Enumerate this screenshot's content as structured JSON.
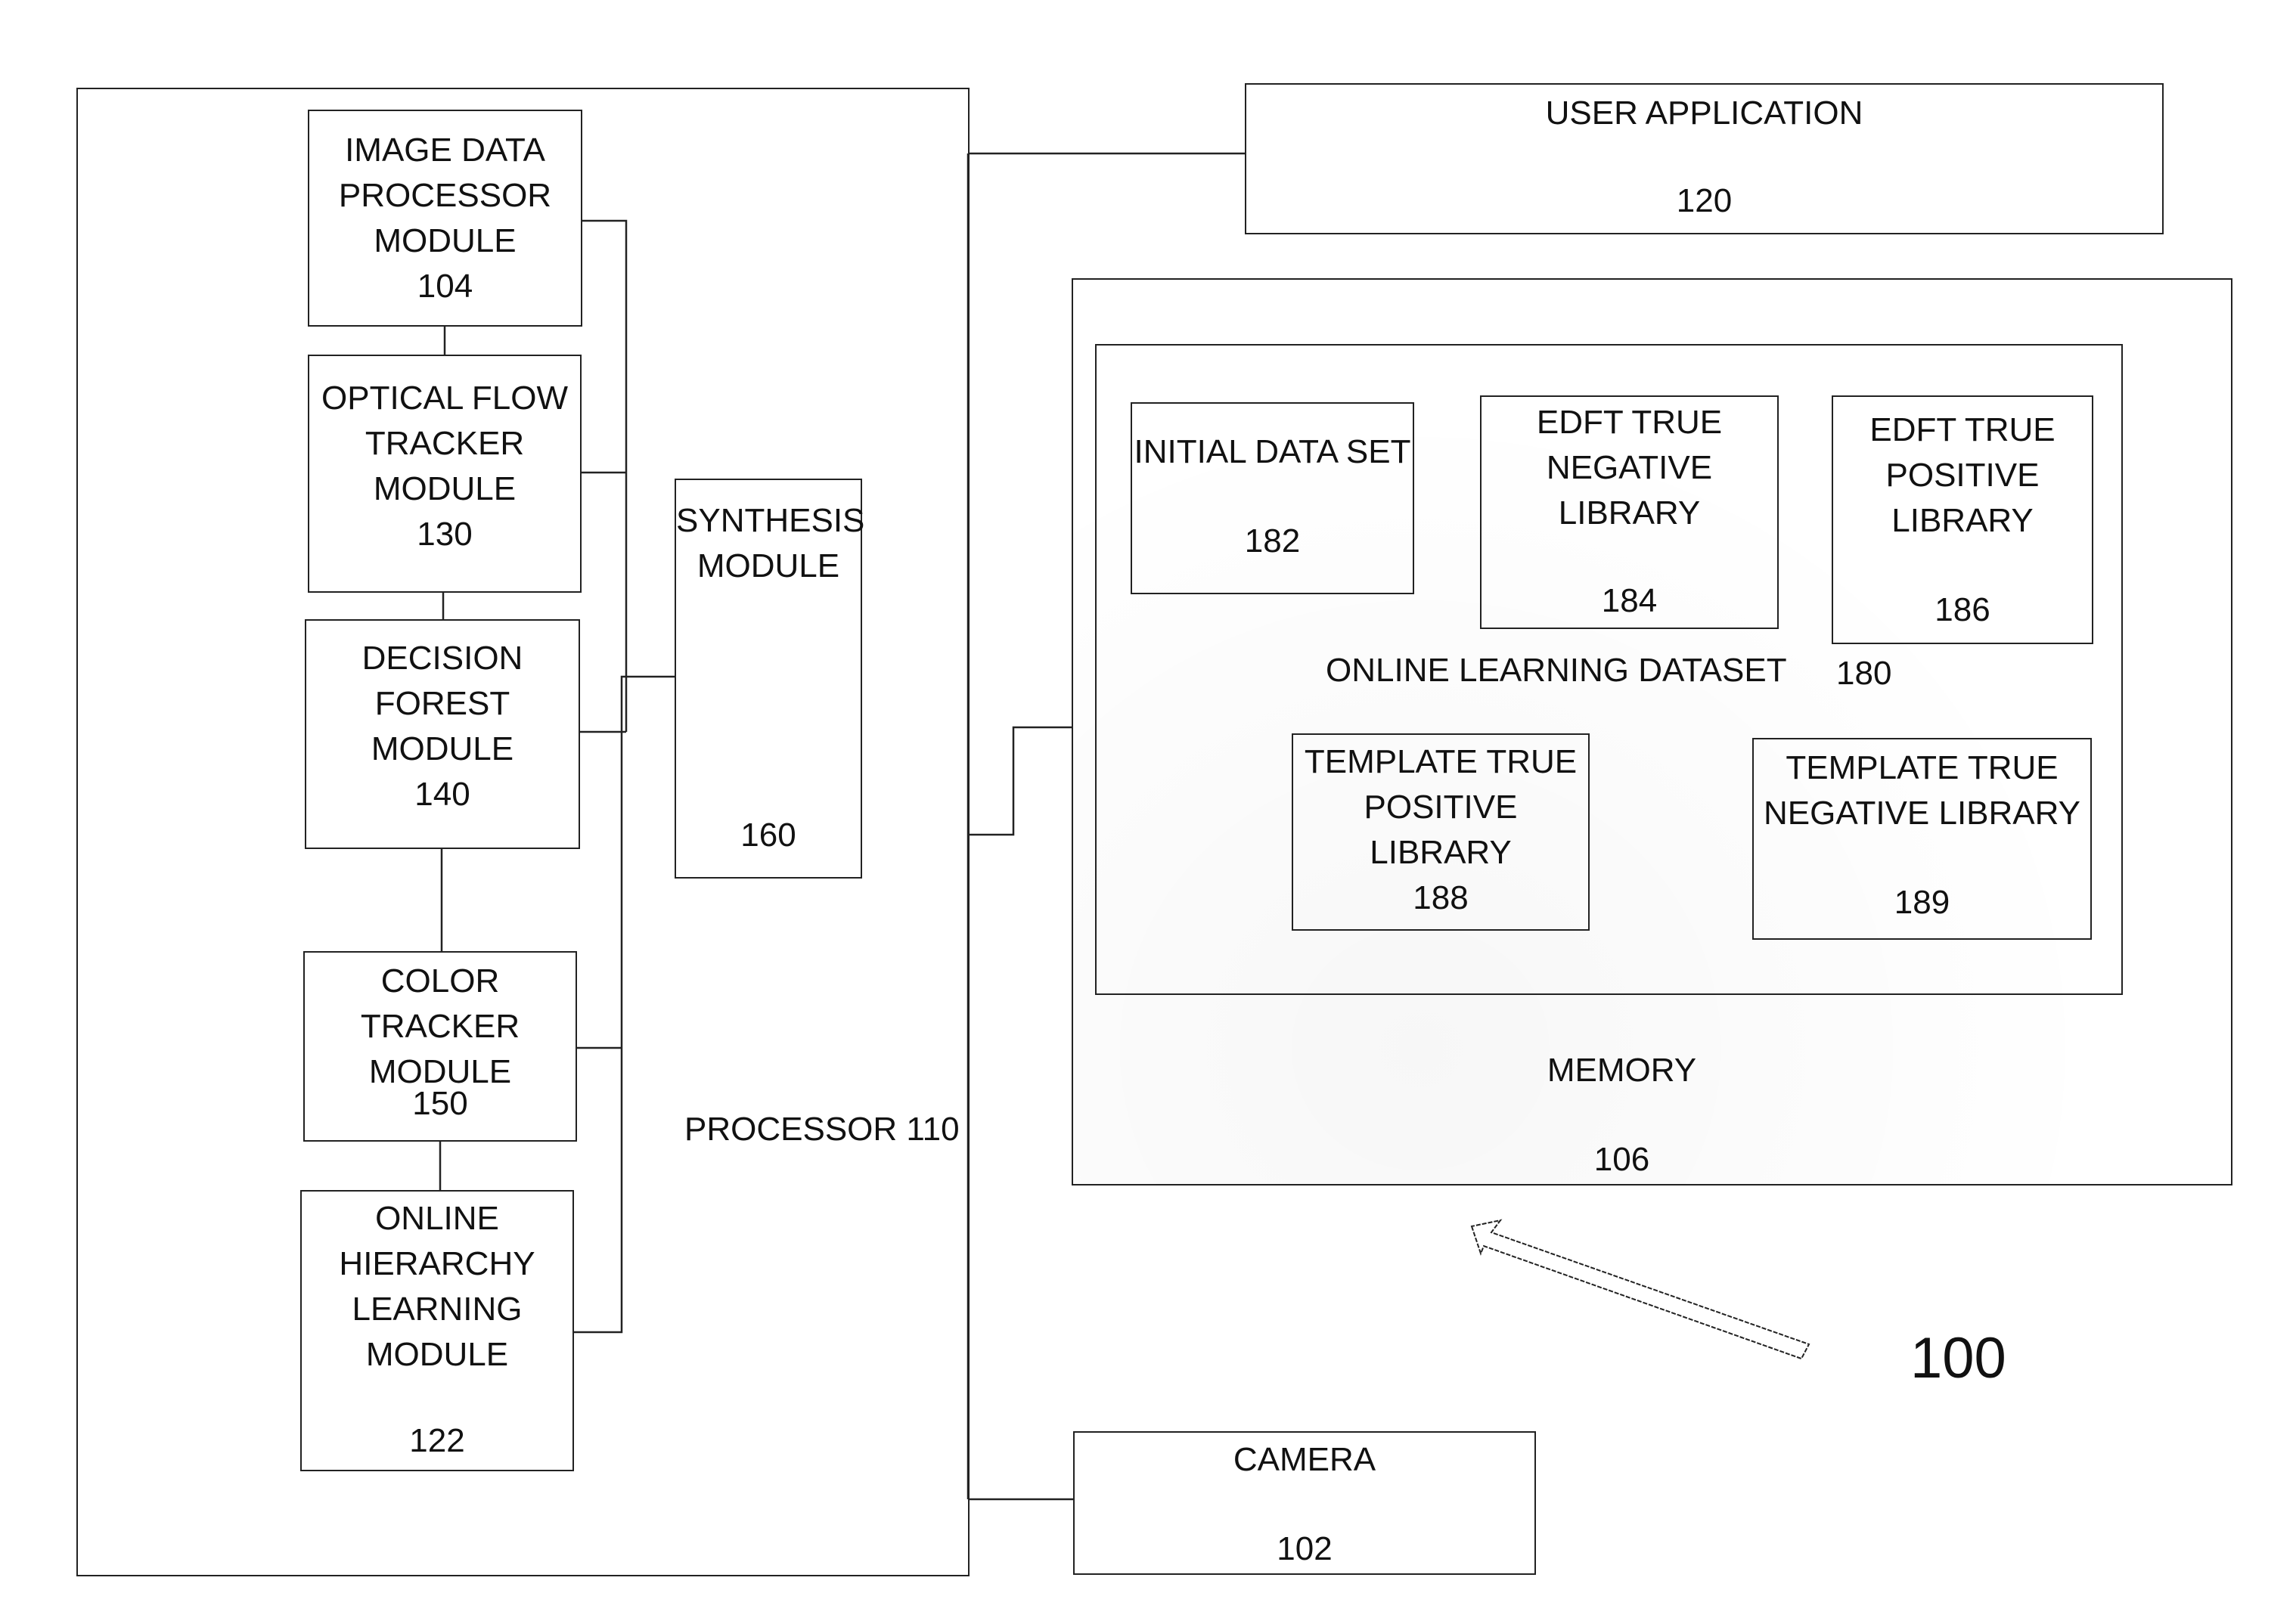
{
  "figure_number": "100",
  "processor": {
    "label": "PROCESSOR 110"
  },
  "modules": {
    "image_data_processor": {
      "label": "IMAGE DATA\nPROCESSOR\nMODULE",
      "number": "104"
    },
    "optical_flow_tracker": {
      "label": "OPTICAL FLOW\nTRACKER\nMODULE",
      "number": "130"
    },
    "decision_forest": {
      "label": "DECISION\nFOREST\nMODULE",
      "number": "140"
    },
    "color_tracker": {
      "label": "COLOR TRACKER\nMODULE",
      "number": "150"
    },
    "online_hierarchy_learning": {
      "label": "ONLINE\nHIERARCHY\nLEARNING\nMODULE",
      "number": "122"
    },
    "synthesis": {
      "label": "SYNTHESIS\nMODULE",
      "number": "160"
    }
  },
  "user_application": {
    "label": "USER APPLICATION",
    "number": "120"
  },
  "memory": {
    "label": "MEMORY",
    "number": "106",
    "online_learning_dataset": {
      "label": "ONLINE LEARNING DATASET",
      "number": "180",
      "libraries": {
        "initial_data_set": {
          "label": "INITIAL DATA SET",
          "number": "182"
        },
        "edft_true_negative": {
          "label": "EDFT TRUE\nNEGATIVE\nLIBRARY",
          "number": "184"
        },
        "edft_true_positive": {
          "label": "EDFT TRUE\nPOSITIVE\nLIBRARY",
          "number": "186"
        },
        "template_true_positive": {
          "label": "TEMPLATE TRUE\nPOSITIVE LIBRARY",
          "number": "188"
        },
        "template_true_negative": {
          "label": "TEMPLATE TRUE\nNEGATIVE LIBRARY",
          "number": "189"
        }
      }
    }
  },
  "camera": {
    "label": "CAMERA",
    "number": "102"
  }
}
